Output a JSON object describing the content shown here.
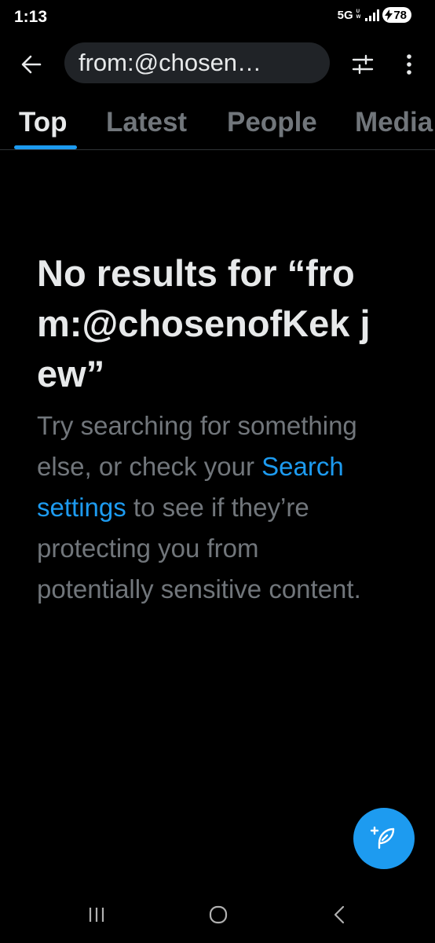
{
  "status_bar": {
    "time": "1:13",
    "network": "5G",
    "network_sub_top": "U",
    "network_sub_bottom": "W",
    "battery_level": "78"
  },
  "search": {
    "query": "from:@chosen…"
  },
  "tabs": [
    {
      "label": "Top",
      "active": true
    },
    {
      "label": "Latest",
      "active": false
    },
    {
      "label": "People",
      "active": false
    },
    {
      "label": "Media",
      "active": false
    }
  ],
  "empty_state": {
    "title": "No results for “from:@chosenofKek jew”",
    "desc_before_link": "Try searching for something else, or check your ",
    "link_text": "Search settings",
    "desc_after_link": " to see if they’re protecting you from potentially sensitive content."
  },
  "colors": {
    "background": "#000000",
    "accent": "#1d9bf0",
    "primary_text": "#e7e9ea",
    "secondary_text": "#71767b",
    "search_pill": "#202327"
  },
  "icons": {
    "back": "arrow-left-icon",
    "filter": "sliders-icon",
    "more": "more-vertical-icon",
    "compose": "compose-feather-icon",
    "nav_recents": "recents-icon",
    "nav_home": "home-circle-icon",
    "nav_back": "chevron-left-icon"
  }
}
